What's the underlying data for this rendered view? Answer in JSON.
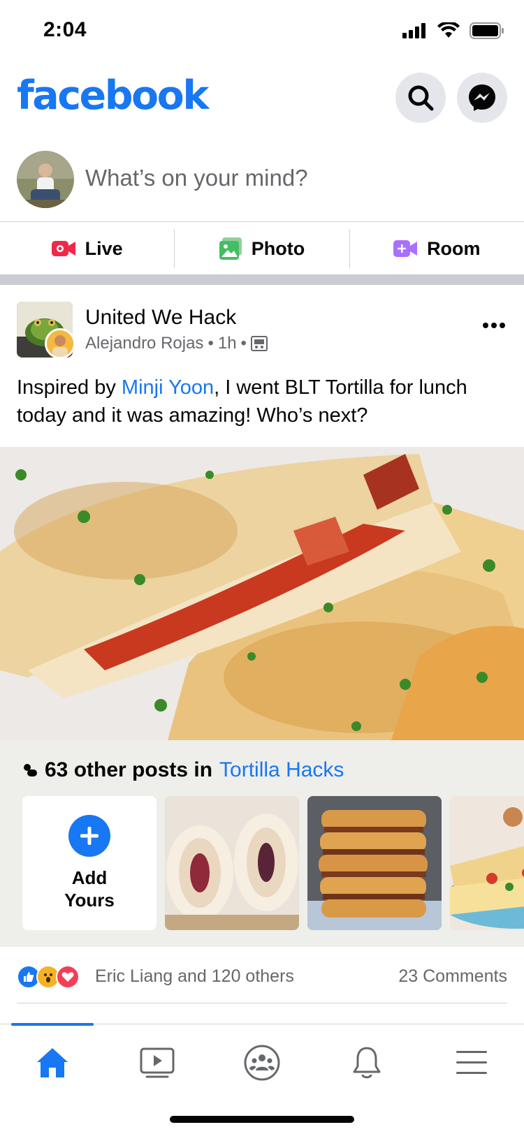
{
  "status_bar": {
    "time": "2:04"
  },
  "header": {
    "logo": "facebook",
    "search_icon": "search-icon",
    "messenger_icon": "messenger-icon"
  },
  "composer": {
    "placeholder": "What’s on your mind?"
  },
  "actions": [
    {
      "label": "Live",
      "icon": "live-video-icon",
      "color": "#f02849"
    },
    {
      "label": "Photo",
      "icon": "photo-icon",
      "color": "#45bd62"
    },
    {
      "label": "Room",
      "icon": "room-icon",
      "color": "#a970ff"
    }
  ],
  "post": {
    "group_name": "United We Hack",
    "author": "Alejandro Rojas",
    "time": "1h",
    "text_before": "Inspired by ",
    "mention": "Minji Yoon",
    "text_after": ", I went BLT Tortilla for lunch today and it was amazing! Who’s next?"
  },
  "hacks": {
    "title_prefix": "63 other posts in ",
    "link": "Tortilla Hacks",
    "add_label_line1": "Add",
    "add_label_line2": "Yours"
  },
  "reactions": {
    "summary": "Eric Liang and 120 others",
    "comments": "23 Comments",
    "types": [
      "like",
      "wow",
      "love"
    ]
  },
  "tabbar": {
    "tabs": [
      "home-icon",
      "watch-icon",
      "groups-icon",
      "notifications-icon",
      "menu-icon"
    ],
    "active": "home",
    "accent": "#1877f2"
  }
}
